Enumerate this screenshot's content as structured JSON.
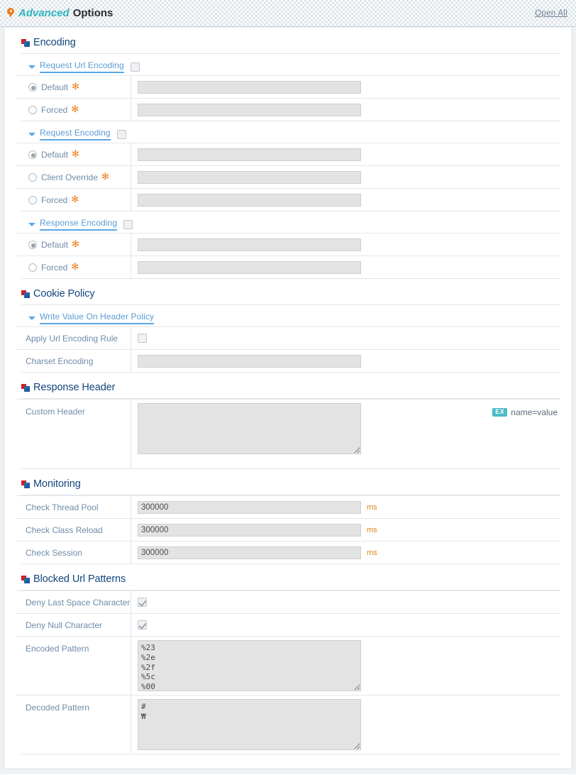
{
  "titlebar": {
    "pin_icon": "pin-icon",
    "title_accent": "Advanced",
    "title_rest": "Options",
    "open_all": "Open All",
    "accent_color": "#2fb5bd",
    "pin_color": "#f07d1a"
  },
  "sections": {
    "encoding": {
      "title": "Encoding",
      "subsections": {
        "request_url_encoding": {
          "label": "Request Url Encoding",
          "checkbox_checked": false,
          "options": [
            {
              "label": "Default",
              "selected": true,
              "required": "✻",
              "value": ""
            },
            {
              "label": "Forced",
              "selected": false,
              "required": "✻",
              "value": ""
            }
          ]
        },
        "request_encoding": {
          "label": "Request Encoding",
          "checkbox_checked": false,
          "options": [
            {
              "label": "Default",
              "selected": true,
              "required": "✻",
              "value": ""
            },
            {
              "label": "Client Override",
              "selected": false,
              "required": "✻",
              "value": ""
            },
            {
              "label": "Forced",
              "selected": false,
              "required": "✻",
              "value": ""
            }
          ]
        },
        "response_encoding": {
          "label": "Response Encoding",
          "checkbox_checked": false,
          "options": [
            {
              "label": "Default",
              "selected": true,
              "required": "✻",
              "value": ""
            },
            {
              "label": "Forced",
              "selected": false,
              "required": "✻",
              "value": ""
            }
          ]
        }
      }
    },
    "cookie_policy": {
      "title": "Cookie Policy",
      "subsection_label": "Write Value On Header Policy",
      "fields": [
        {
          "label": "Apply Url Encoding Rule",
          "type": "checkbox",
          "checked": false
        },
        {
          "label": "Charset Encoding",
          "type": "text",
          "value": ""
        }
      ]
    },
    "response_header": {
      "title": "Response Header",
      "fields": [
        {
          "label": "Custom Header",
          "type": "textarea",
          "value": ""
        }
      ],
      "hint_badge": "EX",
      "hint_text": "name=value",
      "hint_badge_color": "#4cbcc6"
    },
    "monitoring": {
      "title": "Monitoring",
      "unit": "ms",
      "unit_color": "#e0820f",
      "fields": [
        {
          "label": "Check Thread Pool",
          "value": "300000",
          "unit": "ms"
        },
        {
          "label": "Check Class Reload",
          "value": "300000",
          "unit": "ms"
        },
        {
          "label": "Check Session",
          "value": "300000",
          "unit": "ms"
        }
      ]
    },
    "blocked_url_patterns": {
      "title": "Blocked Url Patterns",
      "fields": [
        {
          "label": "Deny Last Space Character",
          "type": "checkbox",
          "checked": true
        },
        {
          "label": "Deny Null Character",
          "type": "checkbox",
          "checked": true
        },
        {
          "label": "Encoded Pattern",
          "type": "textarea",
          "value": "%23\n%2e\n%2f\n%5c\n%00"
        },
        {
          "label": "Decoded Pattern",
          "type": "textarea",
          "value": "#\n₩"
        }
      ]
    }
  }
}
